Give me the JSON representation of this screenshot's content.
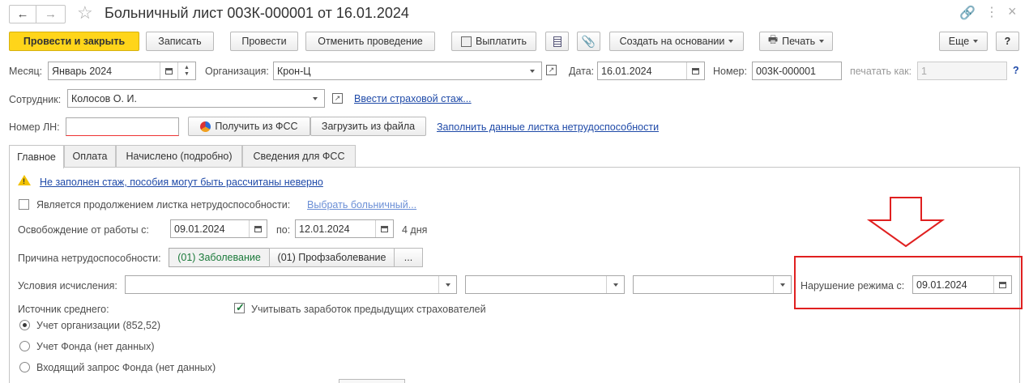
{
  "window": {
    "title": "Больничный лист 003К-000001 от 16.01.2024"
  },
  "toolbar": {
    "post_close": "Провести и закрыть",
    "save": "Записать",
    "post": "Провести",
    "cancel_post": "Отменить проведение",
    "pay": "Выплатить",
    "create_based": "Создать на основании",
    "print": "Печать",
    "more": "Еще",
    "help": "?"
  },
  "header": {
    "month_label": "Месяц:",
    "month_value": "Январь 2024",
    "org_label": "Организация:",
    "org_value": "Крон-Ц",
    "date_label": "Дата:",
    "date_value": "16.01.2024",
    "number_label": "Номер:",
    "number_value": "003К-000001",
    "print_as_label": "печатать как:",
    "print_as_value": "1",
    "help_q": "?",
    "employee_label": "Сотрудник:",
    "employee_value": "Колосов О. И.",
    "insurance_link": "Ввести страховой стаж...",
    "ln_label": "Номер ЛН:",
    "ln_value": "",
    "get_fss": "Получить из ФСС",
    "load_file": "Загрузить из файла",
    "fill_link": "Заполнить данные листка нетрудоспособности"
  },
  "tabs": [
    {
      "label": "Главное"
    },
    {
      "label": "Оплата"
    },
    {
      "label": "Начислено (подробно)"
    },
    {
      "label": "Сведения для ФСС"
    }
  ],
  "main": {
    "warning_link": "Не заполнен стаж, пособия могут быть рассчитаны неверно",
    "continuation_label": "Является продолжением листка нетрудоспособности:",
    "choose_sick_link": "Выбрать больничный...",
    "release_label": "Освобождение от работы с:",
    "release_from": "09.01.2024",
    "release_to_label": "по:",
    "release_to": "12.01.2024",
    "days": "4 дня",
    "reason_label": "Причина нетрудоспособности:",
    "reason_opt1": "(01) Заболевание",
    "reason_opt2": "(01) Профзаболевание",
    "reason_more": "...",
    "conditions_label": "Условия исчисления:",
    "violation_label": "Нарушение режима с:",
    "violation_value": "09.01.2024",
    "source_label": "Источник среднего:",
    "consider_prev_label": "Учитывать заработок предыдущих страхователей",
    "source_opts": [
      {
        "label": "Учет организации (852,52)"
      },
      {
        "label": "Учет Фонда (нет данных)"
      },
      {
        "label": "Входящий запрос Фонда (нет данных)"
      }
    ]
  },
  "colors": {
    "primary": "#ffd51a",
    "link": "#1f4aa8",
    "annotation": "#e02020",
    "active_option": "#1b7a3a"
  }
}
